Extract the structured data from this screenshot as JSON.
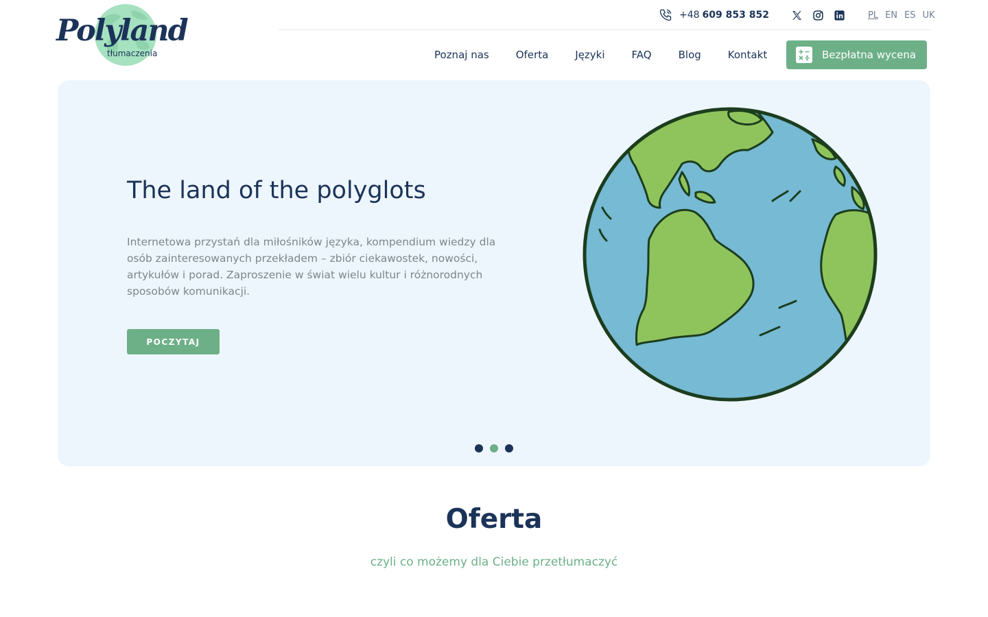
{
  "brand": {
    "name": "Polyland",
    "tagline": "tłumaczenia"
  },
  "topbar": {
    "phone_prefix": "+48",
    "phone_number": "609 853 852",
    "socials": [
      "x-icon",
      "instagram-icon",
      "linkedin-icon"
    ],
    "languages": [
      "PL",
      "EN",
      "ES",
      "UK"
    ],
    "active_language": "PL"
  },
  "nav": {
    "items": [
      "Poznaj nas",
      "Oferta",
      "Języki",
      "FAQ",
      "Blog",
      "Kontakt"
    ],
    "cta_label": "Bezpłatna wycena",
    "cta_icon": "calculator-icon"
  },
  "hero": {
    "title": "The land of the polyglots",
    "text": "Internetowa przystań dla miłośników języka, kompendium wiedzy dla osób zainteresowanych przekładem – zbiór ciekawostek, nowości, artykułów i porad. Zaproszenie w świat wielu kultur i różnorodnych sposobów komunikacji.",
    "button_label": "POCZYTAJ",
    "slide_count": 3,
    "active_slide": 2
  },
  "offer": {
    "title": "Oferta",
    "subtitle": "czyli co możemy dla Ciebie przetłumaczyć"
  },
  "colors": {
    "navy": "#1b3358",
    "green": "#6db088",
    "hero_bg": "#eef6fd",
    "ocean": "#76bad3",
    "land": "#8fc45c",
    "outline": "#1c3d1e"
  }
}
